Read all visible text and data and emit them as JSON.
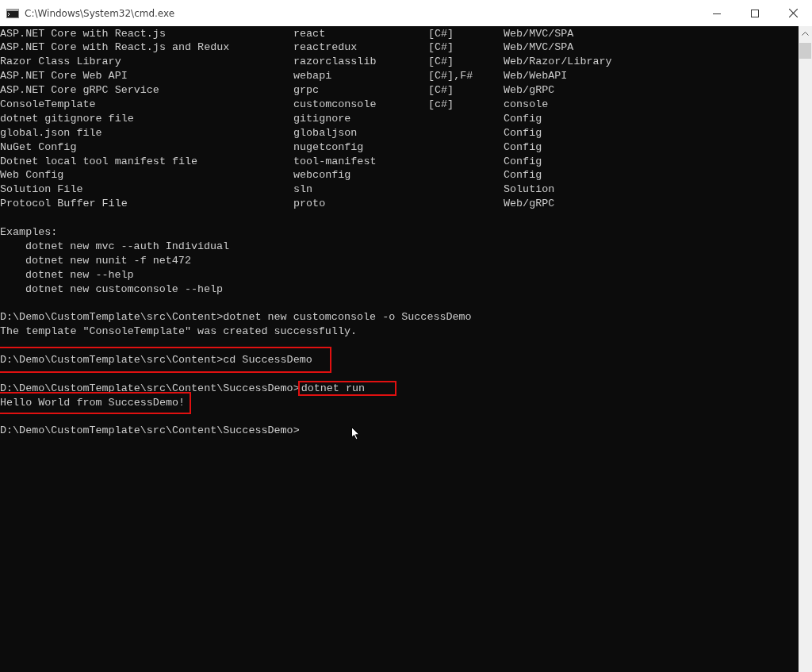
{
  "window": {
    "title": "C:\\Windows\\System32\\cmd.exe"
  },
  "templates": [
    {
      "name": "ASP.NET Core with React.js",
      "short_name": "react",
      "language": "[C#]",
      "tags": "Web/MVC/SPA"
    },
    {
      "name": "ASP.NET Core with React.js and Redux",
      "short_name": "reactredux",
      "language": "[C#]",
      "tags": "Web/MVC/SPA"
    },
    {
      "name": "Razor Class Library",
      "short_name": "razorclasslib",
      "language": "[C#]",
      "tags": "Web/Razor/Library"
    },
    {
      "name": "ASP.NET Core Web API",
      "short_name": "webapi",
      "language": "[C#],F#",
      "tags": "Web/WebAPI"
    },
    {
      "name": "ASP.NET Core gRPC Service",
      "short_name": "grpc",
      "language": "[C#]",
      "tags": "Web/gRPC"
    },
    {
      "name": "ConsoleTemplate",
      "short_name": "customconsole",
      "language": "[c#]",
      "tags": "console"
    },
    {
      "name": "dotnet gitignore file",
      "short_name": "gitignore",
      "tags": "Config"
    },
    {
      "name": "global.json file",
      "short_name": "globaljson",
      "tags": "Config"
    },
    {
      "name": "NuGet Config",
      "short_name": "nugetconfig",
      "tags": "Config"
    },
    {
      "name": "Dotnet local tool manifest file",
      "short_name": "tool-manifest",
      "tags": "Config"
    },
    {
      "name": "Web Config",
      "short_name": "webconfig",
      "tags": "Config"
    },
    {
      "name": "Solution File",
      "short_name": "sln",
      "tags": "Solution"
    },
    {
      "name": "Protocol Buffer File",
      "short_name": "proto",
      "tags": "Web/gRPC"
    }
  ],
  "examples_heading": "Examples:",
  "examples": [
    "dotnet new mvc --auth Individual",
    "dotnet new nunit -f net472",
    "dotnet new --help",
    "dotnet new customconsole --help"
  ],
  "session": [
    {
      "kind": "command",
      "prompt": "D:\\Demo\\CustomTemplate\\src\\Content>",
      "command": "dotnet new customconsole -o SuccessDemo",
      "line_highlighted": false,
      "command_highlighted": false
    },
    {
      "kind": "output",
      "text": "The template \"ConsoleTemplate\" was created successfully.",
      "highlighted": false
    },
    {
      "kind": "blank"
    },
    {
      "kind": "command",
      "prompt": "D:\\Demo\\CustomTemplate\\src\\Content>",
      "command": "cd SuccessDemo",
      "line_highlighted": true,
      "command_highlighted": false
    },
    {
      "kind": "blank"
    },
    {
      "kind": "command",
      "prompt": "D:\\Demo\\CustomTemplate\\src\\Content\\SuccessDemo>",
      "command": "dotnet run",
      "line_highlighted": false,
      "command_highlighted": true
    },
    {
      "kind": "output",
      "text": "Hello World from SuccessDemo!",
      "highlighted": true
    },
    {
      "kind": "blank"
    },
    {
      "kind": "prompt",
      "prompt": "D:\\Demo\\CustomTemplate\\src\\Content\\SuccessDemo>"
    }
  ]
}
